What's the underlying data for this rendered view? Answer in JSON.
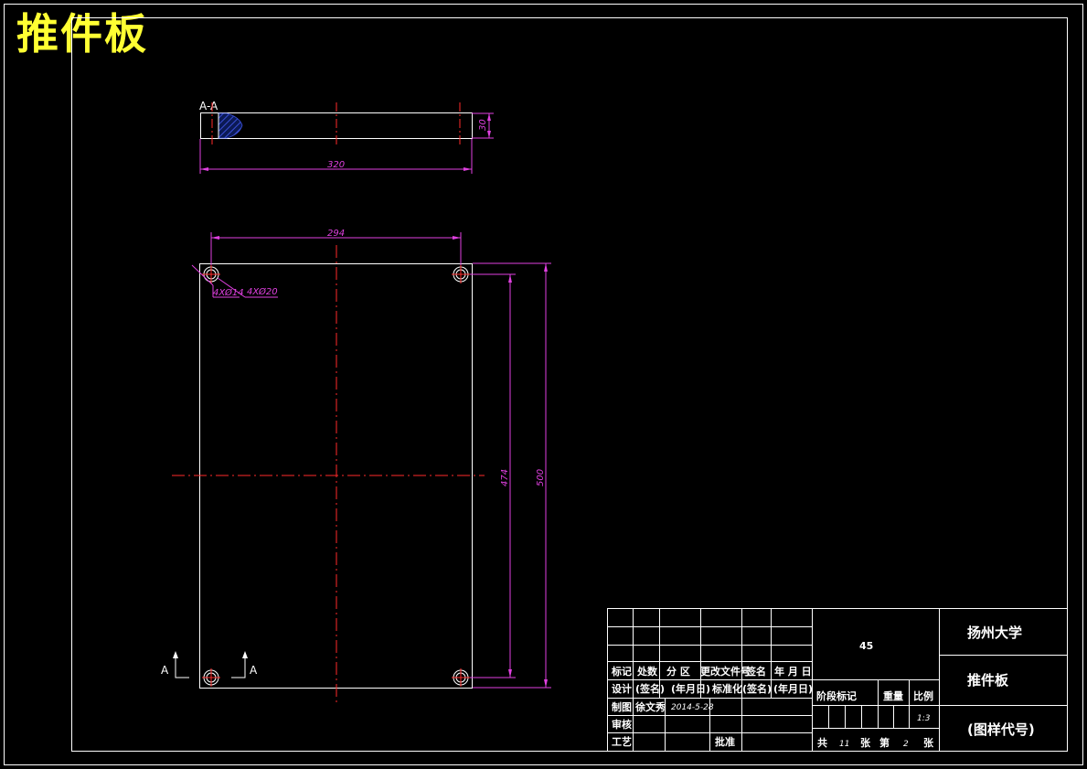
{
  "sheet_title": "推件板",
  "section_label": "A-A",
  "section_marker": "A",
  "dimensions": {
    "length": "320",
    "thickness": "30",
    "hole_spacing_x": "294",
    "hole_spacing_y": "474",
    "height": "500",
    "small_holes": "4XØ14",
    "large_holes": "4XØ20"
  },
  "title_block": {
    "headers": {
      "mark": "标记",
      "count": "处数",
      "zone": "分 区",
      "change_doc": "更改文件号",
      "signature": "签名",
      "date": "年 月 日"
    },
    "row_design": {
      "label": "设计",
      "sign": "(签名)",
      "date": "(年月日)",
      "standard": "标准化",
      "sign2": "(签名)",
      "date2": "(年月日)"
    },
    "row_drawn": {
      "label": "制图",
      "name": "徐文秀",
      "date": "2014-5-28"
    },
    "row_check": {
      "label": "审核"
    },
    "row_process": {
      "label": "工艺",
      "approve": "批准"
    },
    "material": "45",
    "stage_mark": "阶段标记",
    "weight": "重量",
    "scale": "比例",
    "scale_value": "1:3",
    "sheets_total_prefix": "共",
    "sheets_total": "11",
    "sheets_total_suffix": "张",
    "sheet_no_prefix": "第",
    "sheet_no": "2",
    "sheet_no_suffix": "张",
    "school": "扬州大学",
    "part_name": "推件板",
    "drawing_code": "(图样代号)"
  },
  "colors": {
    "background": "#000000",
    "outline": "#ffffff",
    "centerline": "#ff2a2a",
    "dimension": "#e040e0",
    "title": "#ffff33",
    "hatch": "#3a4fd6"
  }
}
